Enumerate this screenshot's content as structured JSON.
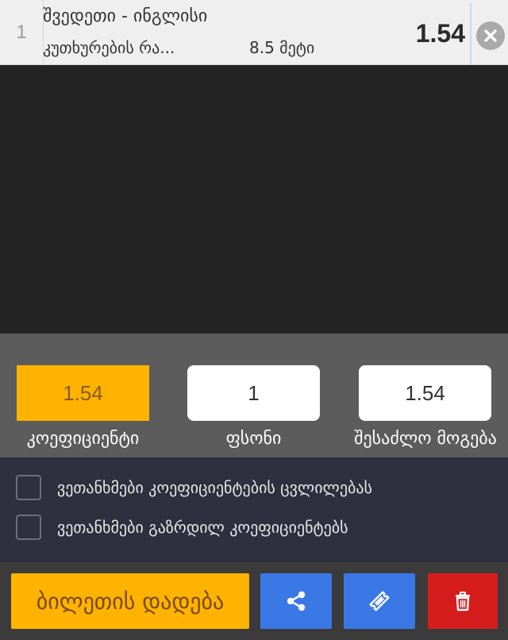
{
  "bet": {
    "index": "1",
    "match": "შვედეთი - ინგლისი",
    "market": "კუთხურების რა...",
    "selection": "8.5 მეტი",
    "odds": "1.54"
  },
  "stake_panel": {
    "odds_value": "1.54",
    "stake_value": "1",
    "possible_win_value": "1.54",
    "odds_label": "კოეფიციენტი",
    "stake_label": "ფსონი",
    "possible_win_label": "შესაძლო მოგება"
  },
  "options": {
    "accept_odds_change": "ვეთანხმები კოეფიციენტების ცვლილებას",
    "accept_boosted_odds": "ვეთანხმები გაზრდილ კოეფიციენტებს"
  },
  "actions": {
    "place_bet_label": "ბილეთის დადება"
  },
  "icons": {
    "remove": "close-circle-icon",
    "share": "share-icon",
    "ticket": "ticket-icon",
    "delete": "trash-icon"
  },
  "colors": {
    "accent": "#ffb300",
    "primary_button": "#3a78e6",
    "danger_button": "#d61d1d",
    "stake_panel_bg": "#5c5c5c",
    "options_bg": "#2e3040"
  }
}
